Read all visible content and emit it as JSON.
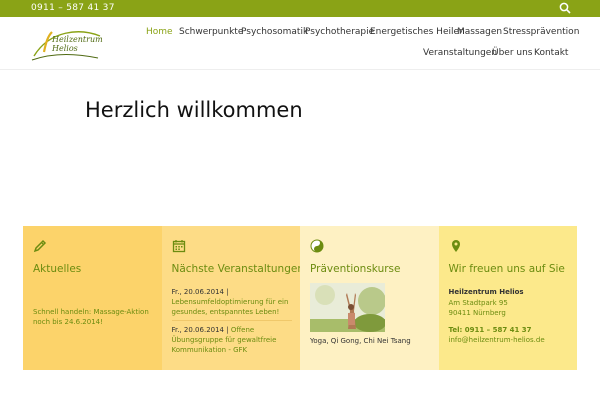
{
  "topbar": {
    "phone": "0911 – 587 41 37",
    "search_icon": "search-icon"
  },
  "logo": {
    "line1": "Heilzentrum",
    "line2": "Helios"
  },
  "nav": {
    "items": [
      {
        "label": "Home",
        "active": true
      },
      {
        "label": "Schwerpunkte"
      },
      {
        "label": "Psychosomatik"
      },
      {
        "label": "Psychotherapie"
      },
      {
        "label": "Energetisches Heilen"
      },
      {
        "label": "Massagen"
      },
      {
        "label": "Stressprävention"
      },
      {
        "label": "Veranstaltungen"
      },
      {
        "label": "Über uns"
      },
      {
        "label": "Kontakt"
      }
    ]
  },
  "main": {
    "title": "Herzlich willkommen"
  },
  "boxes": [
    {
      "icon": "pencil-icon",
      "title": "Aktuelles",
      "text": "Schnell handeln: Massage-Aktion noch bis 24.6.2014!"
    },
    {
      "icon": "calendar-icon",
      "title": "Nächste Veranstaltungen",
      "events": [
        {
          "date": "Fr., 20.06.2014 |",
          "text": "Lebensumfeldoptimierung für ein gesundes, entspanntes Leben!"
        },
        {
          "date": "Fr., 20.06.2014 |",
          "text": "Offene Übungsgruppe für gewaltfreie Kommunikation - GFK"
        }
      ]
    },
    {
      "icon": "yin-yang-icon",
      "title": "Präventionskurse",
      "caption": "Yoga, Qi Gong, Chi Nei Tsang"
    },
    {
      "icon": "location-pin-icon",
      "title": "Wir freuen uns auf Sie",
      "name": "Heilzentrum Helios",
      "address1": "Am Stadtpark 95",
      "address2": "90411 Nürnberg",
      "tel": "Tel: 0911 – 587 41 37",
      "email": "info@heilzentrum-helios.de"
    }
  ],
  "colors": {
    "accent": "#8aa316",
    "box1": "#fcd36a",
    "box2": "#fddc86",
    "box3": "#fef1c3",
    "box4": "#fce98b"
  }
}
